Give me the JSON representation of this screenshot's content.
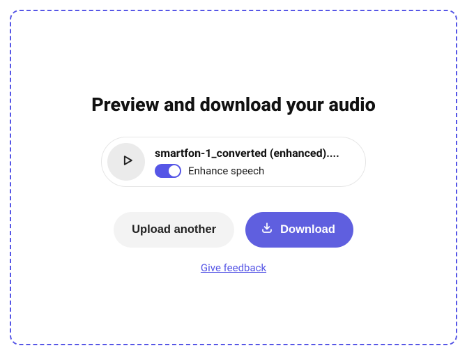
{
  "title": "Preview and download your audio",
  "file": {
    "name": "smartfon-1_converted (enhanced)...."
  },
  "enhance": {
    "label": "Enhance speech",
    "on": true
  },
  "buttons": {
    "upload": "Upload another",
    "download": "Download"
  },
  "feedback": "Give feedback",
  "colors": {
    "accent": "#5656e6"
  }
}
